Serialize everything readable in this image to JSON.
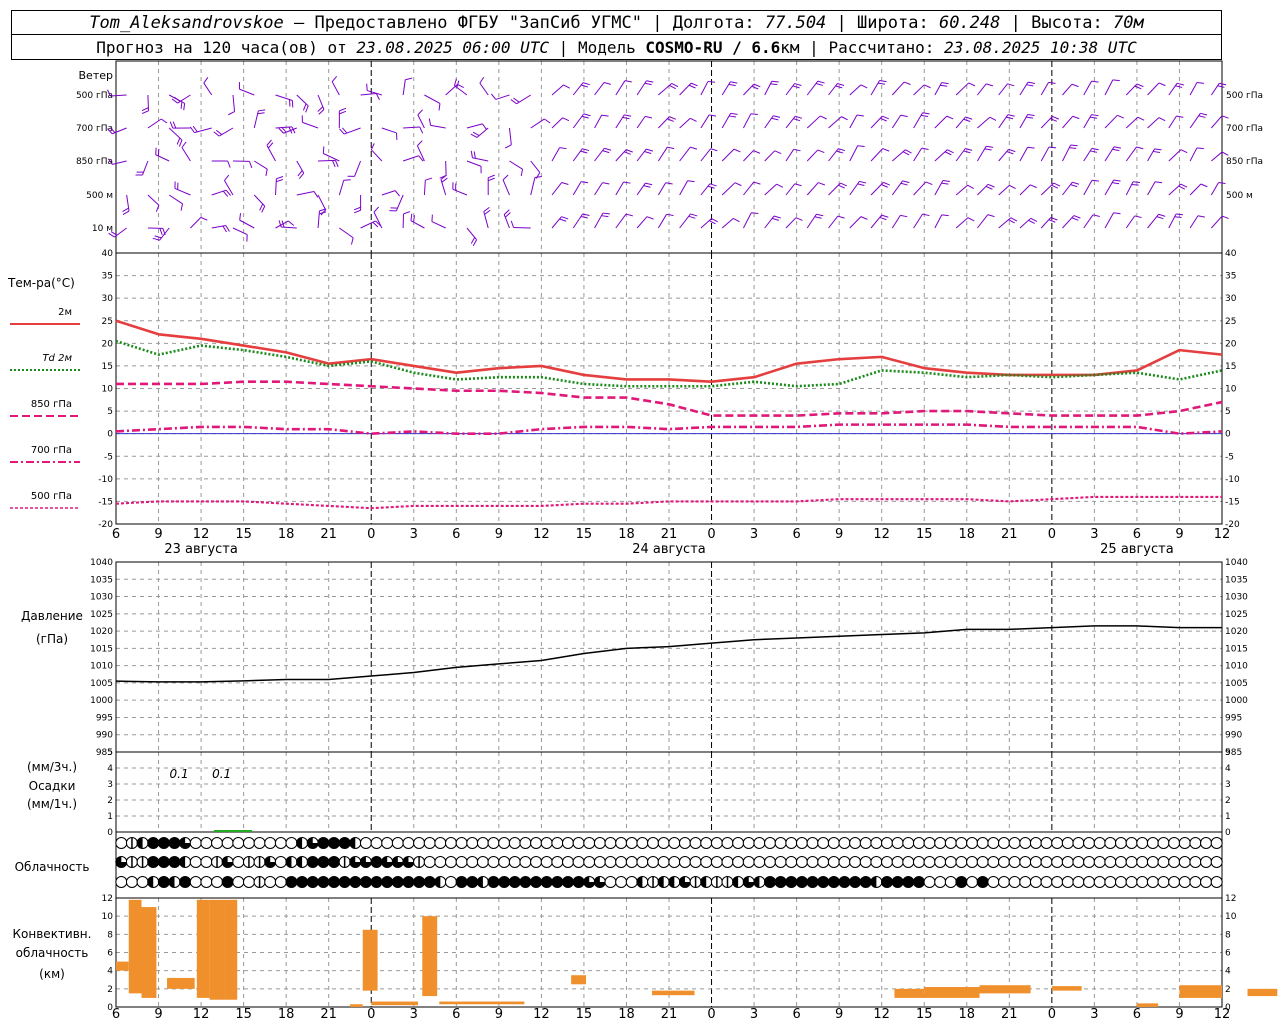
{
  "header": {
    "station": "Tom_Aleksandrovskoe",
    "dash": "—",
    "provider": "Предоставлено ФГБУ \"ЗапСиб УГМС\"",
    "sep": "|",
    "lon_label": "Долгота:",
    "lon_value": "77.504",
    "lat_label": "Широта:",
    "lat_value": "60.248",
    "alt_label": "Высота:",
    "alt_value": "70м",
    "forecast_label": "Прогноз на 120 часа(ов) от",
    "forecast_time": "23.08.2025 06:00 UTC",
    "model_label": "Модель",
    "model_name": "COSMO-RU / 6.6",
    "model_unit": "км",
    "calc_label": "Рассчитано:",
    "calc_time": "23.08.2025 10:38 UTC"
  },
  "colors": {
    "wind": "#7b00c8",
    "t2m": "#e53e3e",
    "td2m": "#1a8a1a",
    "t850": "#e0187a",
    "t700": "#e0187a",
    "t500": "#e0187a",
    "pressure": "#000000",
    "precip": "#22aa22",
    "convective": "#f0902c",
    "zero_line": "#3333cc",
    "grid": "#999999"
  },
  "time_axis": {
    "ticks": [
      "6",
      "9",
      "12",
      "15",
      "18",
      "21",
      "0",
      "3",
      "6",
      "9",
      "12",
      "15",
      "18",
      "21",
      "0",
      "3",
      "6",
      "9",
      "12",
      "15",
      "18",
      "21",
      "0",
      "3",
      "6",
      "9",
      "12"
    ],
    "dates": [
      "23 августа",
      "24 августа",
      "25 августа"
    ],
    "date_index": [
      2,
      13,
      24
    ]
  },
  "wind_panel": {
    "title": "Ветер",
    "levels": [
      "500 гПа",
      "700 гПа",
      "850 гПа",
      "500 м",
      "10  м"
    ]
  },
  "temperature_panel": {
    "title": "Тем-ра(°С)",
    "legend": [
      {
        "label": "2м",
        "style": "solid"
      },
      {
        "label": "Td 2м",
        "style": "dotted"
      },
      {
        "label": "850 гПа",
        "style": "dashed"
      },
      {
        "label": "700 гПа",
        "style": "dashdot"
      },
      {
        "label": "500 гПа",
        "style": "finedash"
      }
    ],
    "ticks": [
      "40",
      "35",
      "30",
      "25",
      "20",
      "15",
      "10",
      "5",
      "0",
      "-5",
      "-10",
      "-15",
      "-20"
    ]
  },
  "pressure_panel": {
    "title": "Давление",
    "unit": "(гПа)",
    "ticks": [
      "1040",
      "1035",
      "1030",
      "1025",
      "1020",
      "1015",
      "1010",
      "1005",
      "1000",
      "995",
      "990",
      "985"
    ]
  },
  "precip_panel": {
    "unit3h": "(мм/3ч.)",
    "title": "Осадки",
    "unit1h": "(мм/1ч.)",
    "ticks": [
      "5",
      "4",
      "3",
      "2",
      "1",
      "0"
    ],
    "labels": [
      {
        "text": "0.1",
        "index": 2
      },
      {
        "text": "0.1",
        "index": 3
      }
    ]
  },
  "cloud_panel": {
    "title": "Облачность"
  },
  "convective_panel": {
    "title1": "Конвективн.",
    "title2": "облачность",
    "unit": "(км)",
    "ticks": [
      "12",
      "10",
      "8",
      "6",
      "4",
      "2",
      "0"
    ]
  },
  "chart_data": [
    {
      "type": "line",
      "name": "temperature",
      "ylim": [
        -20,
        40
      ],
      "x": [
        0,
        1,
        2,
        3,
        4,
        5,
        6,
        7,
        8,
        9,
        10,
        11,
        12,
        13,
        14,
        15,
        16,
        17,
        18,
        19,
        20,
        21,
        22,
        23,
        24,
        25,
        26
      ],
      "series": [
        {
          "name": "2м",
          "values": [
            25,
            22,
            21,
            19.5,
            18,
            15.5,
            16.5,
            15,
            13.5,
            14.5,
            15,
            13,
            12,
            12,
            11.5,
            12.5,
            15.5,
            16.5,
            17,
            14.5,
            13.5,
            13,
            13,
            13,
            14,
            18.5,
            17.5
          ]
        },
        {
          "name": "Td 2м",
          "values": [
            20.5,
            17.5,
            19.5,
            18.5,
            17,
            15,
            16,
            13.5,
            12,
            12.5,
            12.5,
            11,
            10.5,
            10.5,
            10.5,
            11.5,
            10.5,
            11,
            14,
            13.5,
            12.5,
            13,
            12.5,
            13,
            13.5,
            12,
            14
          ]
        },
        {
          "name": "850 гПа",
          "values": [
            11,
            11,
            11,
            11.5,
            11.5,
            11,
            10.5,
            10,
            9.5,
            9.5,
            9,
            8,
            8,
            6.5,
            4,
            4,
            4,
            4.5,
            4.5,
            5,
            5,
            4.5,
            4,
            4,
            4,
            5,
            7
          ]
        },
        {
          "name": "700 гПа",
          "values": [
            0.5,
            1,
            1.5,
            1.5,
            1,
            1,
            0,
            0.5,
            0,
            0,
            1,
            1.5,
            1.5,
            1,
            1.5,
            1.5,
            1.5,
            2,
            2,
            2,
            2,
            1.5,
            1.5,
            1.5,
            1.5,
            0,
            0.5
          ]
        },
        {
          "name": "500 гПа",
          "values": [
            -15.5,
            -15,
            -15,
            -15,
            -15.5,
            -16,
            -16.5,
            -16,
            -16,
            -16,
            -16,
            -15.5,
            -15.5,
            -15,
            -15,
            -15,
            -15,
            -14.5,
            -14.5,
            -14.5,
            -14.5,
            -15,
            -14.5,
            -14,
            -14,
            -14,
            -14
          ]
        }
      ]
    },
    {
      "type": "line",
      "name": "pressure",
      "ylim": [
        985,
        1040
      ],
      "x": [
        0,
        1,
        2,
        3,
        4,
        5,
        6,
        7,
        8,
        9,
        10,
        11,
        12,
        13,
        14,
        15,
        16,
        17,
        18,
        19,
        20,
        21,
        22,
        23,
        24,
        25,
        26
      ],
      "series": [
        {
          "name": "pressure",
          "values": [
            1005.5,
            1005.3,
            1005.3,
            1005.6,
            1006,
            1006,
            1007,
            1008,
            1009.5,
            1010.5,
            1011.5,
            1013.5,
            1015,
            1015.5,
            1016.5,
            1017.5,
            1018,
            1018.5,
            1019,
            1019.5,
            1020.5,
            1020.5,
            1021,
            1021.5,
            1021.5,
            1021,
            1021
          ]
        }
      ]
    },
    {
      "type": "bar",
      "name": "precipitation",
      "ylim": [
        0,
        5
      ],
      "bars": [
        {
          "x": 2.3,
          "w": 0.9,
          "value": 0.1
        }
      ]
    },
    {
      "type": "bar",
      "name": "convective_cloud",
      "ylim": [
        0,
        12
      ],
      "bars": [
        {
          "x": 0.0,
          "w": 0.3,
          "base": 4.0,
          "top": 5.0
        },
        {
          "x": 0.3,
          "w": 0.3,
          "base": 1.5,
          "top": 11.8
        },
        {
          "x": 0.6,
          "w": 0.35,
          "base": 1.0,
          "top": 11.0
        },
        {
          "x": 1.2,
          "w": 0.65,
          "base": 2.0,
          "top": 3.2
        },
        {
          "x": 1.9,
          "w": 0.3,
          "base": 1.0,
          "top": 11.8
        },
        {
          "x": 2.2,
          "w": 0.35,
          "base": 0.8,
          "top": 11.8
        },
        {
          "x": 2.55,
          "w": 0.3,
          "base": 0.8,
          "top": 11.8
        },
        {
          "x": 5.5,
          "w": 0.3,
          "base": 0.0,
          "top": 0.3
        },
        {
          "x": 5.8,
          "w": 0.35,
          "base": 1.8,
          "top": 8.5
        },
        {
          "x": 6.0,
          "w": 1.1,
          "base": 0.2,
          "top": 0.6
        },
        {
          "x": 7.2,
          "w": 0.35,
          "base": 1.2,
          "top": 10.0
        },
        {
          "x": 7.6,
          "w": 2.0,
          "base": 0.3,
          "top": 0.6
        },
        {
          "x": 10.7,
          "w": 0.35,
          "base": 2.5,
          "top": 3.5
        },
        {
          "x": 12.6,
          "w": 1.0,
          "base": 1.3,
          "top": 1.8
        },
        {
          "x": 18.3,
          "w": 0.7,
          "base": 1.0,
          "top": 2.0
        },
        {
          "x": 19.0,
          "w": 1.3,
          "base": 1.0,
          "top": 2.2
        },
        {
          "x": 20.3,
          "w": 1.2,
          "base": 1.5,
          "top": 2.4
        },
        {
          "x": 22.0,
          "w": 0.7,
          "base": 1.8,
          "top": 2.3
        },
        {
          "x": 24.0,
          "w": 0.5,
          "base": 0.0,
          "top": 0.4
        },
        {
          "x": 25.0,
          "w": 1.0,
          "base": 1.0,
          "top": 2.4
        },
        {
          "x": 26.6,
          "w": 0.7,
          "base": 1.2,
          "top": 2.0
        }
      ]
    }
  ],
  "clouds": {
    "rows": [
      "01244430000000000234442000000000000000000000000000000000000000000000000000000000000000000000000000000000",
      "31144420013011302244413343331000000000000000000000000000000000000000000000000000000000000000000000000000",
      "00024240004001004444444444444420442444444444330002122312112324444444444244440004040000000000000000000000"
    ]
  }
}
